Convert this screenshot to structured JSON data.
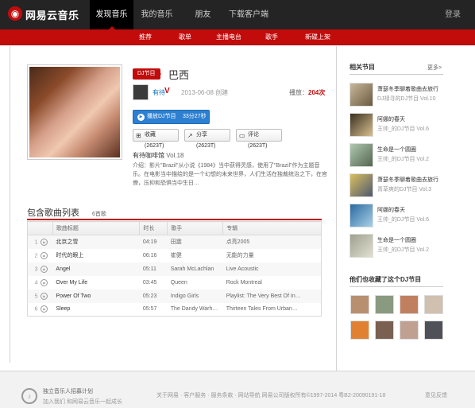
{
  "nav": {
    "logo": "网易云音乐",
    "items": [
      {
        "label": "发现音乐",
        "active": true
      },
      {
        "label": "我的音乐",
        "active": false
      },
      {
        "label": "朋友",
        "active": false
      },
      {
        "label": "下载客户端",
        "active": false
      }
    ],
    "login": "登录"
  },
  "subnav": [
    "推荐",
    "歌单",
    "主播电台",
    "歌手",
    "新碟上架"
  ],
  "program": {
    "tag": "DJ节目",
    "title": "巴西",
    "dj_name": "有待",
    "created": "2013-06-08 创建",
    "plays_label": "播放：",
    "plays_count": "204次",
    "play_button": "播放DJ节目",
    "play_length": "33分27秒",
    "collect": "收藏(2623T)",
    "share": "分享(2623T)",
    "comment": "评论(2623T)",
    "show_name": "有待咖啡馆",
    "show_vol": "Vol.18",
    "desc": "介绍：影片\"Brazil\"从小说《1984》当中获得灵感，使用了\"Brazil\"作为主题音乐。在电影当中描绘的是一个幻想的未来世界，人们生活在独裁统治之下，在官僚，压抑和恐惧当中生日…"
  },
  "songs": {
    "title": "包含歌曲列表",
    "count": "6首歌",
    "headers": [
      "",
      "歌曲标题",
      "时长",
      "歌手",
      "专辑"
    ],
    "rows": [
      {
        "idx": "1",
        "title": "北京之雪",
        "dur": "04:19",
        "artist": "田震",
        "album": "点亮2005"
      },
      {
        "idx": "2",
        "title": "时代的眼上",
        "dur": "06:16",
        "artist": "崔健",
        "album": "无能的力量"
      },
      {
        "idx": "3",
        "title": "Angel",
        "dur": "05:11",
        "artist": "Sarah McLachlan",
        "album": "Live Acoustic"
      },
      {
        "idx": "4",
        "title": "Over My Life",
        "dur": "03:45",
        "artist": "Queen",
        "album": "Rock Montreal"
      },
      {
        "idx": "5",
        "title": "Power Of Two",
        "dur": "05:23",
        "artist": "Indigo Girls",
        "album": "Playlist: The Very Best Of In…"
      },
      {
        "idx": "6",
        "title": "Sleep",
        "dur": "05:57",
        "artist": "The Dandy Warh…",
        "album": "Thirteen Tales From Urban…"
      }
    ]
  },
  "sidebar": {
    "related_title": "相关节目",
    "more": "更多>",
    "programs": [
      {
        "title": "萧瑟冬季聊着歌曲去旅行",
        "dj": "DJ禄寻的DJ节目 Vol.10"
      },
      {
        "title": "阿娜的春天",
        "dj": "王帅_的DJ节目 Vol.6"
      },
      {
        "title": "生命是一个圆圈",
        "dj": "王帅_的DJ节目 Vol.2"
      },
      {
        "title": "萧瑟冬季聊着歌曲去旅行",
        "dj": "青草爽的DJ节目 Vol.3"
      },
      {
        "title": "阿娜的春天",
        "dj": "王帅_的DJ节目 Vol.6"
      },
      {
        "title": "生命是一个圆圈",
        "dj": "王帅_的DJ节目 Vol.2"
      }
    ],
    "fans_title": "他们也收藏了这个DJ节目"
  },
  "footer": {
    "plan_title": "独立音乐人招募计划",
    "plan_sub": "加入我们 和网易云音乐一起成长",
    "links": "关于网易 · 客户服务 · 服务条款 · 网站导航     网易公司版权所有©1997-2014   粤B2-20090191-18",
    "feedback": "意见反馈"
  },
  "colors": {
    "accent": "#c20c0c",
    "topbar": "#242424",
    "link": "#0c73c2",
    "button_blue": "#2d80d1"
  }
}
